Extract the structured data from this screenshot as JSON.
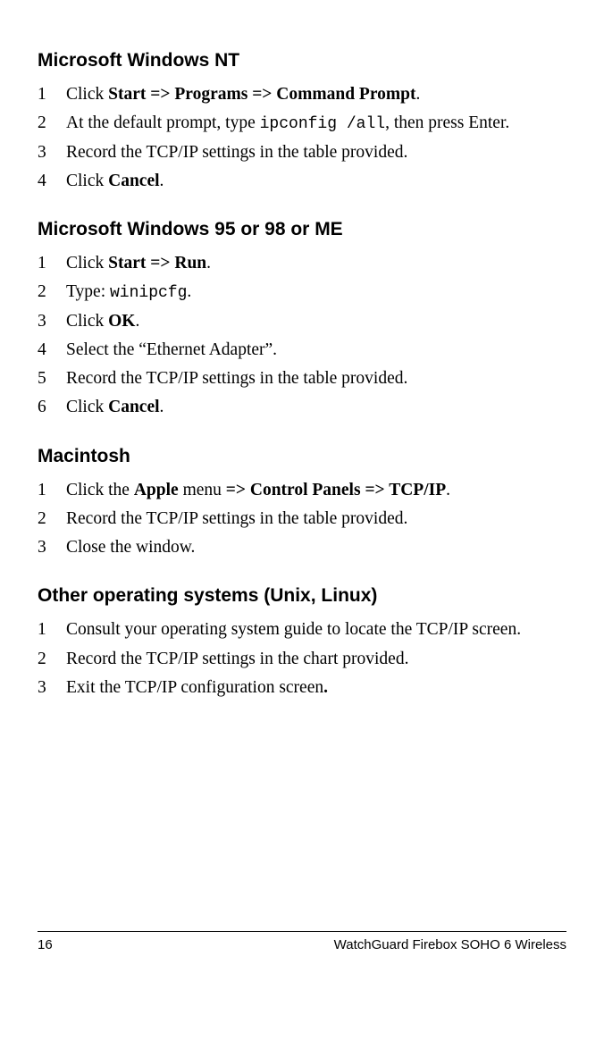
{
  "sections": [
    {
      "heading": "Microsoft Windows NT",
      "steps": [
        {
          "n": "1",
          "parts": [
            {
              "t": "Click ",
              "c": ""
            },
            {
              "t": "Start ",
              "c": "bold"
            },
            {
              "t": "=>",
              "c": "arrows"
            },
            {
              "t": " Programs ",
              "c": "bold"
            },
            {
              "t": "=>",
              "c": "arrows"
            },
            {
              "t": " Command Prompt",
              "c": "bold"
            },
            {
              "t": ".",
              "c": ""
            }
          ]
        },
        {
          "n": "2",
          "parts": [
            {
              "t": "At the default prompt, type ",
              "c": ""
            },
            {
              "t": "ipconfig /all",
              "c": "code"
            },
            {
              "t": ", then press Enter.",
              "c": ""
            }
          ]
        },
        {
          "n": "3",
          "parts": [
            {
              "t": "Record the TCP/IP settings in the table provided.",
              "c": ""
            }
          ]
        },
        {
          "n": "4",
          "parts": [
            {
              "t": "Click ",
              "c": ""
            },
            {
              "t": "Cancel",
              "c": "bold"
            },
            {
              "t": ".",
              "c": ""
            }
          ]
        }
      ]
    },
    {
      "heading": "Microsoft Windows 95 or 98 or ME",
      "steps": [
        {
          "n": "1",
          "parts": [
            {
              "t": "Click ",
              "c": ""
            },
            {
              "t": "Start ",
              "c": "bold"
            },
            {
              "t": "=>",
              "c": "arrows"
            },
            {
              "t": " Run",
              "c": "bold"
            },
            {
              "t": ".",
              "c": ""
            }
          ]
        },
        {
          "n": "2",
          "parts": [
            {
              "t": "Type: ",
              "c": ""
            },
            {
              "t": "winipcfg",
              "c": "code"
            },
            {
              "t": ".",
              "c": ""
            }
          ]
        },
        {
          "n": "3",
          "parts": [
            {
              "t": "Click ",
              "c": ""
            },
            {
              "t": "OK",
              "c": "bold"
            },
            {
              "t": ".",
              "c": ""
            }
          ]
        },
        {
          "n": "4",
          "parts": [
            {
              "t": "Select the “Ethernet Adapter”.",
              "c": ""
            }
          ]
        },
        {
          "n": "5",
          "parts": [
            {
              "t": "Record the TCP/IP settings in the table provided.",
              "c": ""
            }
          ]
        },
        {
          "n": "6",
          "parts": [
            {
              "t": "Click ",
              "c": ""
            },
            {
              "t": "Cancel",
              "c": "bold"
            },
            {
              "t": ".",
              "c": ""
            }
          ]
        }
      ]
    },
    {
      "heading": "Macintosh",
      "steps": [
        {
          "n": "1",
          "parts": [
            {
              "t": "Click the ",
              "c": ""
            },
            {
              "t": "Apple",
              "c": "bold"
            },
            {
              "t": " menu ",
              "c": ""
            },
            {
              "t": "=>",
              "c": "arrows"
            },
            {
              "t": " Control Panels ",
              "c": "bold"
            },
            {
              "t": "=>",
              "c": "arrows"
            },
            {
              "t": " TCP/IP",
              "c": "bold"
            },
            {
              "t": ".",
              "c": ""
            }
          ]
        },
        {
          "n": "2",
          "parts": [
            {
              "t": "Record the TCP/IP settings in the table provided.",
              "c": ""
            }
          ]
        },
        {
          "n": "3",
          "parts": [
            {
              "t": "Close the window.",
              "c": ""
            }
          ]
        }
      ]
    },
    {
      "heading": "Other operating systems (Unix, Linux)",
      "steps": [
        {
          "n": "1",
          "parts": [
            {
              "t": "Consult your operating system guide to locate the TCP/IP screen.",
              "c": ""
            }
          ]
        },
        {
          "n": "2",
          "parts": [
            {
              "t": "Record the TCP/IP settings in the chart provided.",
              "c": ""
            }
          ]
        },
        {
          "n": "3",
          "parts": [
            {
              "t": "Exit the TCP/IP configuration screen",
              "c": ""
            },
            {
              "t": ".",
              "c": "bold"
            }
          ]
        }
      ]
    }
  ],
  "footer": {
    "page_number": "16",
    "title": "WatchGuard Firebox SOHO 6 Wireless"
  }
}
